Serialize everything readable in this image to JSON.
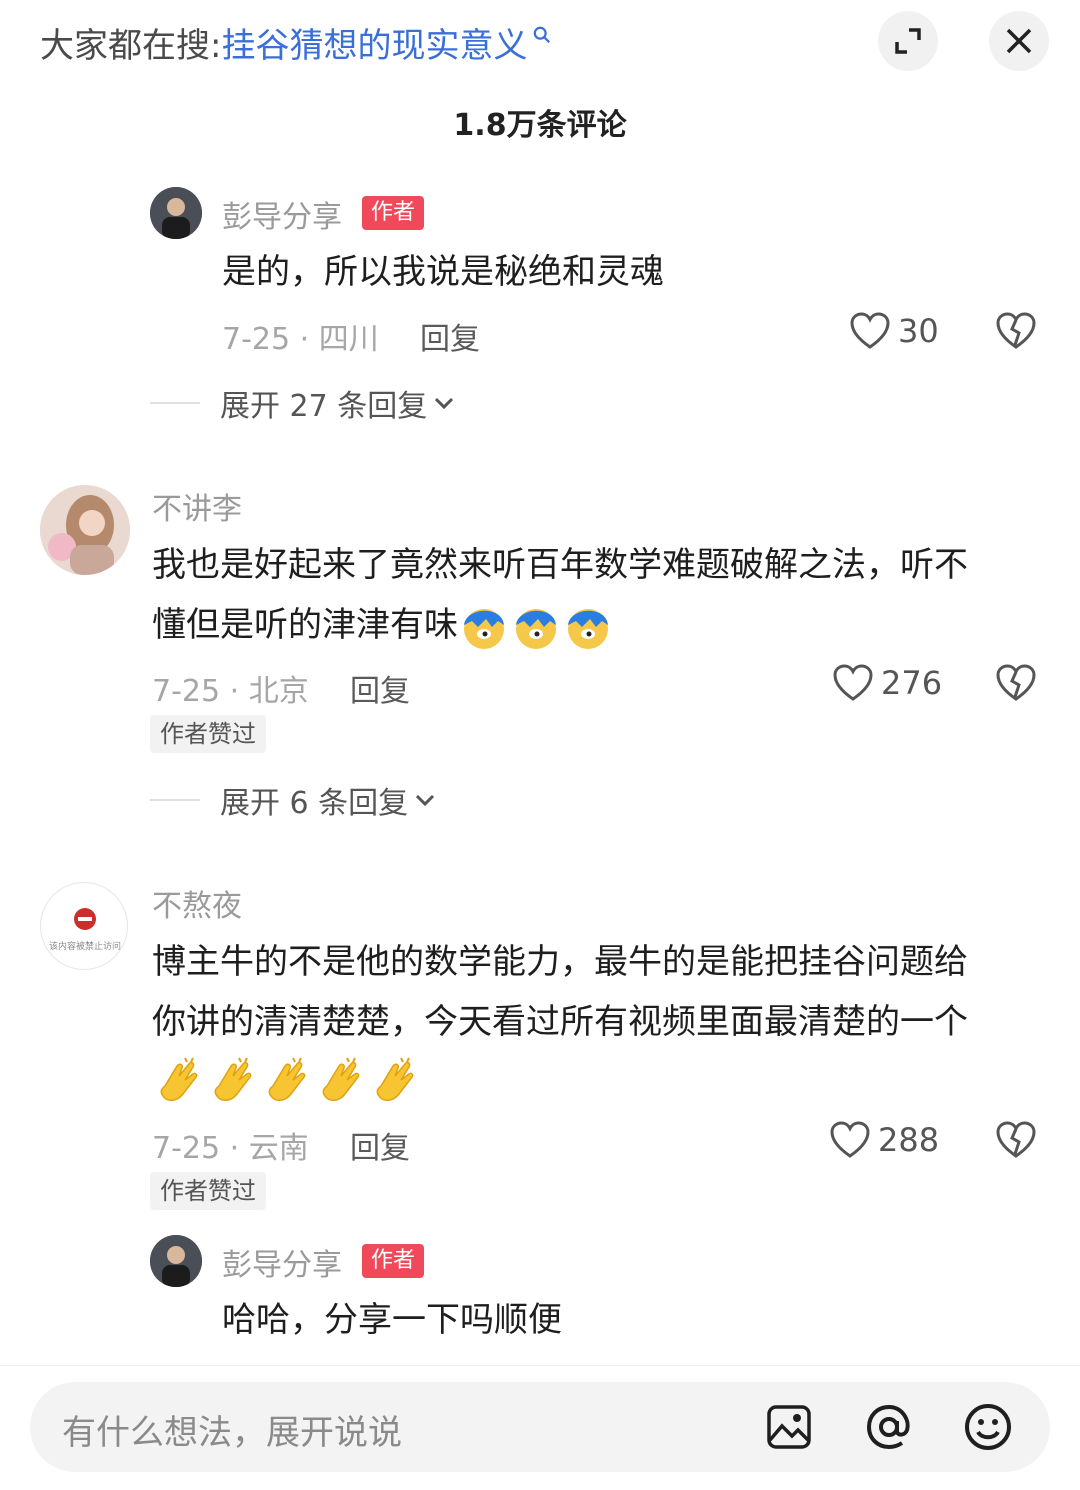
{
  "header": {
    "search_prefix": "大家都在搜:",
    "search_query": "挂谷猜想的现实意义"
  },
  "comment_count": "1.8万条评论",
  "comments": [
    {
      "username": "彭导分享",
      "badge": "作者",
      "text": "是的，所以我说是秘绝和灵魂",
      "meta": "7-25 · 四川",
      "reply": "回复",
      "likes": "30",
      "expand": "展开 27 条回复"
    },
    {
      "username": "不讲李",
      "text_line1": "我也是好起来了竟然来听百年数学难题破解之法，听不",
      "text_line2": "懂但是听的津津有味",
      "meta": "7-25 · 北京",
      "reply": "回复",
      "likes": "276",
      "liked_badge": "作者赞过",
      "expand": "展开 6 条回复"
    },
    {
      "username": "不熬夜",
      "avatar_text": "该内容被禁止访问",
      "text_line1": "博主牛的不是他的数学能力，最牛的是能把挂谷问题给",
      "text_line2": "你讲的清清楚楚，今天看过所有视频里面最清楚的一个",
      "meta": "7-25 · 云南",
      "reply": "回复",
      "likes": "288",
      "liked_badge": "作者赞过"
    },
    {
      "username": "彭导分享",
      "badge": "作者",
      "text": "哈哈，分享一下吗顺便"
    }
  ],
  "input": {
    "placeholder": "有什么想法，展开说说"
  },
  "icons": {
    "expand": "expand-icon",
    "close": "close-icon",
    "like": "heart-icon",
    "dislike": "broken-heart-icon",
    "image": "image-icon",
    "mention": "at-icon",
    "emoji": "emoji-icon"
  }
}
